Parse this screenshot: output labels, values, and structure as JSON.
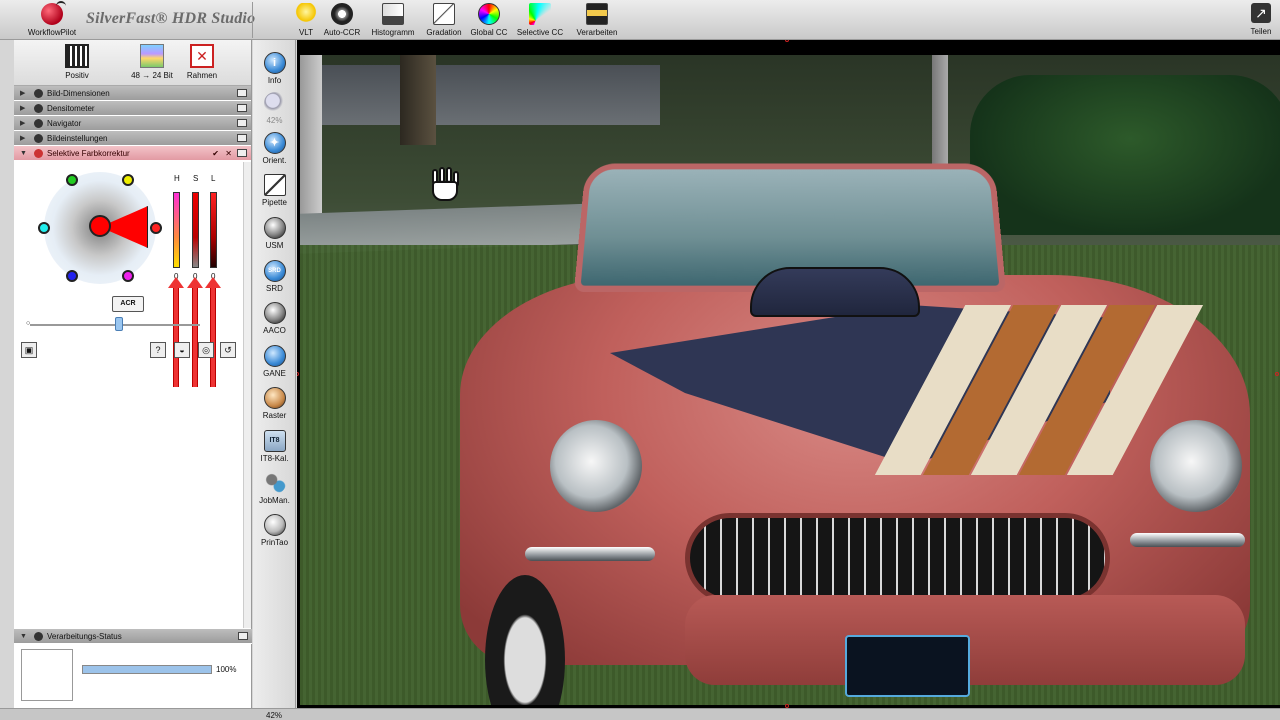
{
  "app": {
    "title": "SilverFast® HDR Studio",
    "workflow_pilot": "WorkflowPilot"
  },
  "toolbar": {
    "items": [
      {
        "label": "VLT",
        "icon": "bulb-icon"
      },
      {
        "label": "Auto-CCR",
        "icon": "auto-ccr-icon"
      },
      {
        "label": "Histogramm",
        "icon": "histogram-icon"
      },
      {
        "label": "Gradation",
        "icon": "gradation-icon"
      },
      {
        "label": "Global CC",
        "icon": "color-wheel-icon"
      },
      {
        "label": "Selective CC",
        "icon": "selective-color-icon"
      },
      {
        "label": "Verarbeiten",
        "icon": "process-icon"
      }
    ],
    "share_label": "Teilen"
  },
  "quick": {
    "positiv": "Positiv",
    "bitdepth": "48 → 24 Bit",
    "rahmen": "Rahmen"
  },
  "sections": {
    "bild_dimensionen": "Bild-Dimensionen",
    "densitometer": "Densitometer",
    "navigator": "Navigator",
    "bildeinstellungen": "Bildeinstellungen",
    "selektive": "Selektive Farbkorrektur"
  },
  "scc": {
    "h_label": "H",
    "s_label": "S",
    "l_label": "L",
    "h_value": "0",
    "s_value": "0",
    "l_value": "0",
    "acr_label": "ACR"
  },
  "status": {
    "title": "Verarbeitungs-Status",
    "percent": "100%",
    "progress": 1.0
  },
  "tools": [
    {
      "label": "Info",
      "icon": "info-icon"
    },
    {
      "label": "42%",
      "icon": "zoom-icon"
    },
    {
      "label": "Orient.",
      "icon": "orientation-icon"
    },
    {
      "label": "Pipette",
      "icon": "pipette-icon"
    },
    {
      "label": "USM",
      "icon": "usm-icon"
    },
    {
      "label": "SRD",
      "icon": "srd-icon"
    },
    {
      "label": "AACO",
      "icon": "aaco-icon"
    },
    {
      "label": "GANE",
      "icon": "gane-icon"
    },
    {
      "label": "Raster",
      "icon": "raster-icon"
    },
    {
      "label": "IT8-Kal.",
      "icon": "it8-icon"
    },
    {
      "label": "JobMan.",
      "icon": "jobman-icon"
    },
    {
      "label": "PrinTao",
      "icon": "printao-icon"
    }
  ],
  "bottom": {
    "zoom": "42%"
  },
  "colors": {
    "active_section": "#e29aa3",
    "accent_red": "#ff0000",
    "arrow_red": "#e33333"
  }
}
